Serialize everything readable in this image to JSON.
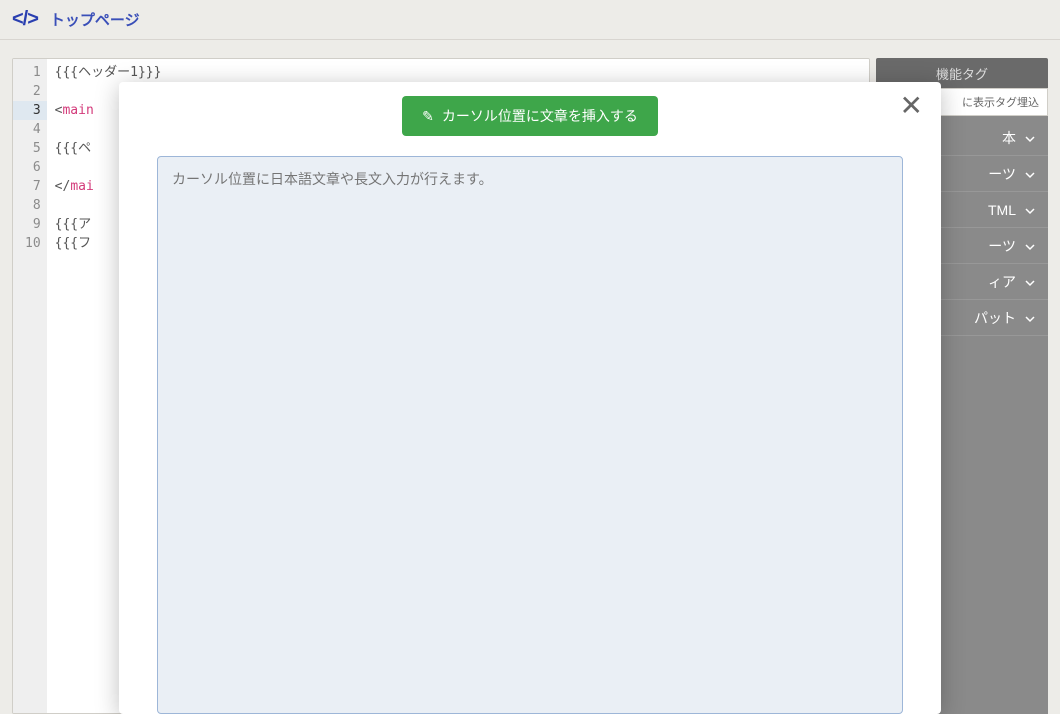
{
  "header": {
    "title": "トップページ"
  },
  "editor": {
    "lines": [
      {
        "n": 1,
        "segments": [
          {
            "t": "{{{ヘッダー1}}}",
            "c": "tok-plain"
          }
        ]
      },
      {
        "n": 2,
        "segments": []
      },
      {
        "n": 3,
        "active": true,
        "segments": [
          {
            "t": "<",
            "c": "tok-plain"
          },
          {
            "t": "main",
            "c": "tok-tag"
          }
        ]
      },
      {
        "n": 4,
        "segments": []
      },
      {
        "n": 5,
        "segments": [
          {
            "t": "{{{ペ",
            "c": "tok-plain"
          }
        ]
      },
      {
        "n": 6,
        "segments": []
      },
      {
        "n": 7,
        "segments": [
          {
            "t": "</",
            "c": "tok-plain"
          },
          {
            "t": "mai",
            "c": "tok-tag"
          }
        ]
      },
      {
        "n": 8,
        "segments": []
      },
      {
        "n": 9,
        "segments": [
          {
            "t": "{{{ア",
            "c": "tok-plain"
          }
        ]
      },
      {
        "n": 10,
        "segments": [
          {
            "t": "{{{フ",
            "c": "tok-plain"
          }
        ]
      }
    ]
  },
  "panel": {
    "tab": "機能タグ",
    "tool": "に表示タグ埋込",
    "items": [
      {
        "label": "本"
      },
      {
        "label": "ーツ"
      },
      {
        "label": "TML"
      },
      {
        "label": "ーツ"
      },
      {
        "label": "ィア"
      },
      {
        "label": "パット"
      }
    ]
  },
  "modal": {
    "insert_label": "カーソル位置に文章を挿入する",
    "placeholder": "カーソル位置に日本語文章や長文入力が行えます。"
  }
}
